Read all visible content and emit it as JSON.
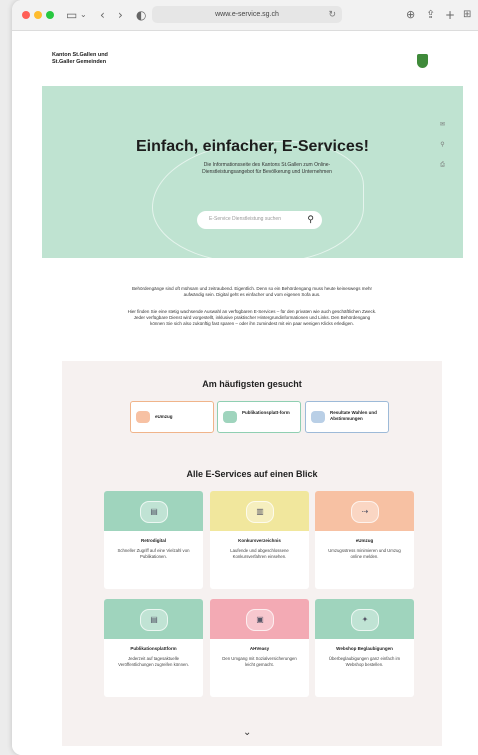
{
  "browser": {
    "url": "www.e-service.sg.ch",
    "nav_icons": [
      "sidebar-icon",
      "back-icon",
      "forward-icon",
      "shield-icon"
    ],
    "action_icons": [
      "download-icon",
      "share-icon",
      "new-tab-icon",
      "tabs-icon"
    ]
  },
  "header": {
    "brand_line1": "Kanton St.Gallen und",
    "brand_line2": "St.Galler Gemeinden"
  },
  "hero": {
    "title": "Einfach, einfacher, E-Services!",
    "subtitle": "Die Informationsseite des Kantons St.Gallen zum Online-Dienstleistungsangebot für Bevölkerung und Unternehmen",
    "search_placeholder": "E-Service Dienstleistung suchen"
  },
  "intro": {
    "p1": "Behördengänge sind oft mühsam und zeitraubend. Eigentlich. Denn so ein Behördengang muss heute keineswegs mehr aufwändig sein. Digital geht es einfacher und vom eigenen Sofa aus.",
    "p2": "Hier finden Sie eine stetig wachsende Auswahl an verfügbaren E-Services – für den privaten wie auch geschäftlichen Zweck. Jeder verfügbare Dienst wird vorgestellt, inklusive praktischer Hintergrundinformationen und Links. Den Behördengang können Sie sich also zukünftig fast sparen – oder ihn zumindest mit ein paar wenigen Klicks erledigen."
  },
  "most_searched": {
    "title": "Am häufigsten gesucht",
    "items": [
      {
        "label": "eUmzug"
      },
      {
        "label": "Publikationsplatt-form"
      },
      {
        "label": "Resultate Wahlen und Abstimmungen"
      }
    ]
  },
  "all_services": {
    "title": "Alle E-Services auf einen Blick",
    "items": [
      {
        "title": "Retrodigital",
        "desc": "Schneller Zugriff auf eine Vielzahl von Publikationen."
      },
      {
        "title": "Konkursverzeichnis",
        "desc": "Laufende und abgeschlossene Konkursverfahren einsehen."
      },
      {
        "title": "eUmzug",
        "desc": "Umzugsstress minimieren und Umzug online melden."
      },
      {
        "title": "Publikationsplattform",
        "desc": "Jederzeit auf tagesaktuelle Veröffentlichungen zugreifen können."
      },
      {
        "title": "AHVeasy",
        "desc": "Den Umgang mit Sozialversicherungen leicht gemacht."
      },
      {
        "title": "Webshop Beglaubigungen",
        "desc": "Überbeglaubigungen ganz einfach im Webshop bestellen."
      }
    ]
  },
  "colors": {
    "hero_bg": "#bfe3d1",
    "panel_bg": "#f6f1f0",
    "green": "#9fd4bd",
    "yellow": "#f1e79d",
    "orange": "#f7c1a3",
    "pink": "#f3aab4",
    "crest": "#3f8a3a"
  }
}
